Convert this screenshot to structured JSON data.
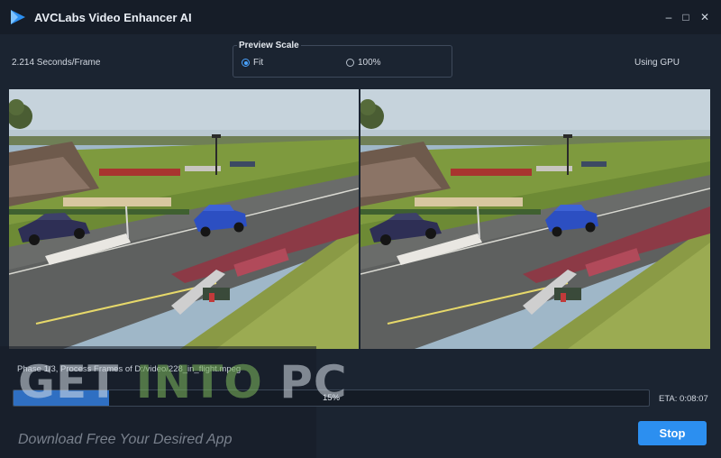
{
  "window": {
    "title": "AVCLabs Video Enhancer AI",
    "minimize_glyph": "–",
    "maximize_glyph": "□",
    "close_glyph": "✕"
  },
  "status": {
    "speed": "2.214 Seconds/Frame",
    "device": "Using GPU"
  },
  "preview_scale": {
    "title": "Preview Scale",
    "options": [
      {
        "label": "Fit",
        "selected": true
      },
      {
        "label": "100%",
        "selected": false
      }
    ]
  },
  "progress": {
    "phase_text": "Phase 1/3, Process Frames of D:/video/228_in_flight.mpeg",
    "percent_label": "15%",
    "percent": 15,
    "eta": "ETA: 0:08:07"
  },
  "actions": {
    "stop_label": "Stop"
  },
  "watermark": {
    "part1": "GET ",
    "part2": "INTO",
    "part3": " PC",
    "tagline": "Download Free Your Desired App"
  },
  "colors": {
    "background": "#1b2431",
    "titlebar": "#161d28",
    "accent": "#2c8ff0",
    "progress_fill": "#2f6fc2"
  }
}
